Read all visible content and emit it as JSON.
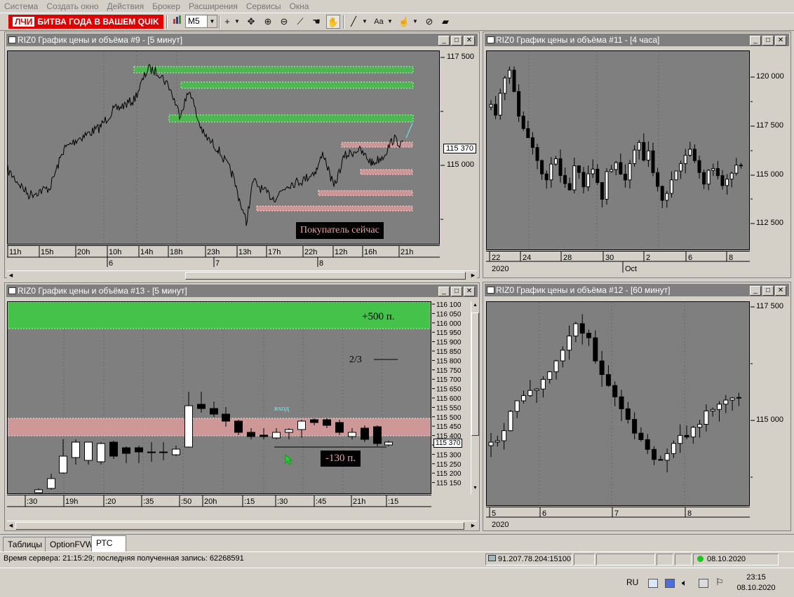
{
  "menu": [
    "Система",
    "Создать окно",
    "Действия",
    "Брокер",
    "Расширения",
    "Сервисы",
    "Окна"
  ],
  "toolbar": {
    "banner_logo": "ЛЧИ",
    "banner_text": "БИТВА ГОДА В ВАШЕМ QUIK",
    "interval": "M5",
    "icons": [
      "chart-settings-icon",
      "crosshair-icon",
      "move-icon",
      "zoom-in-icon",
      "zoom-out-icon",
      "ruler-icon",
      "hand-icon",
      "pan-icon",
      "line-icon",
      "text-icon",
      "pointer-icon",
      "draw-toggle-icon",
      "eraser-icon"
    ]
  },
  "windows": {
    "w9": {
      "title": "RIZ0 График цены и объёма #9 - [5 минут]",
      "price_label": "115 370",
      "annotation": "Покупатель сейчас",
      "x_ticks": [
        "11h",
        "15h",
        "20h",
        "10h",
        "14h",
        "18h",
        "23h",
        "13h",
        "17h",
        "22h",
        "12h",
        "16h",
        "21h"
      ],
      "x_days": [
        "6",
        "7",
        "8"
      ],
      "y_ticks": [
        "117 500",
        "115 000"
      ]
    },
    "w11": {
      "title": "RIZ0 График цены и объёма #11 - [4 часа]",
      "x_ticks": [
        "22",
        "24",
        "28",
        "30",
        "2",
        "6",
        "8"
      ],
      "x_bottom": [
        "2020",
        "Oct"
      ],
      "y_ticks": [
        "120 000",
        "117 500",
        "115 000",
        "112 500"
      ]
    },
    "w13": {
      "title": "RIZ0 График цены и объёма #13 - [5 минут]",
      "price_label": "115 370",
      "note_plus": "+500 п.",
      "note_fraction": "2/3",
      "note_entry": "вход",
      "note_minus": "-130 п.",
      "x_ticks": [
        ":30",
        "19h",
        ":20",
        ":35",
        ":50",
        "20h",
        ":15",
        ":30",
        ":45",
        "21h",
        ":15"
      ],
      "y_ticks": [
        "116 100",
        "116 050",
        "116 000",
        "115 950",
        "115 900",
        "115 850",
        "115 800",
        "115 750",
        "115 700",
        "115 650",
        "115 600",
        "115 550",
        "115 500",
        "115 450",
        "115 400",
        "115 350",
        "115 300",
        "115 250",
        "115 200",
        "115 150"
      ]
    },
    "w12": {
      "title": "RIZ0 График цены и объёма #12 - [60 минут]",
      "x_ticks": [
        "5",
        "6",
        "7",
        "8"
      ],
      "x_bottom": [
        "2020"
      ],
      "y_ticks": [
        "117 500",
        "115 000"
      ]
    }
  },
  "tabs": [
    "Таблицы",
    "OptionFVW",
    "РТС"
  ],
  "selected_tab": "РТС",
  "status": {
    "server_time": "Время сервера: 21:15:29; последняя полученная запись: 62268591",
    "address": "91.207.78.204:15100",
    "date": "08.10.2020"
  },
  "taskbar": {
    "lang": "RU",
    "time": "23:15",
    "date": "08.10.2020"
  },
  "colors": {
    "green_zone": "#44c24a",
    "red_zone": "#e9a0a0",
    "plot_bg": "#7f7f7f",
    "banner": "#e00000",
    "cyan": "#6fe9f0"
  }
}
